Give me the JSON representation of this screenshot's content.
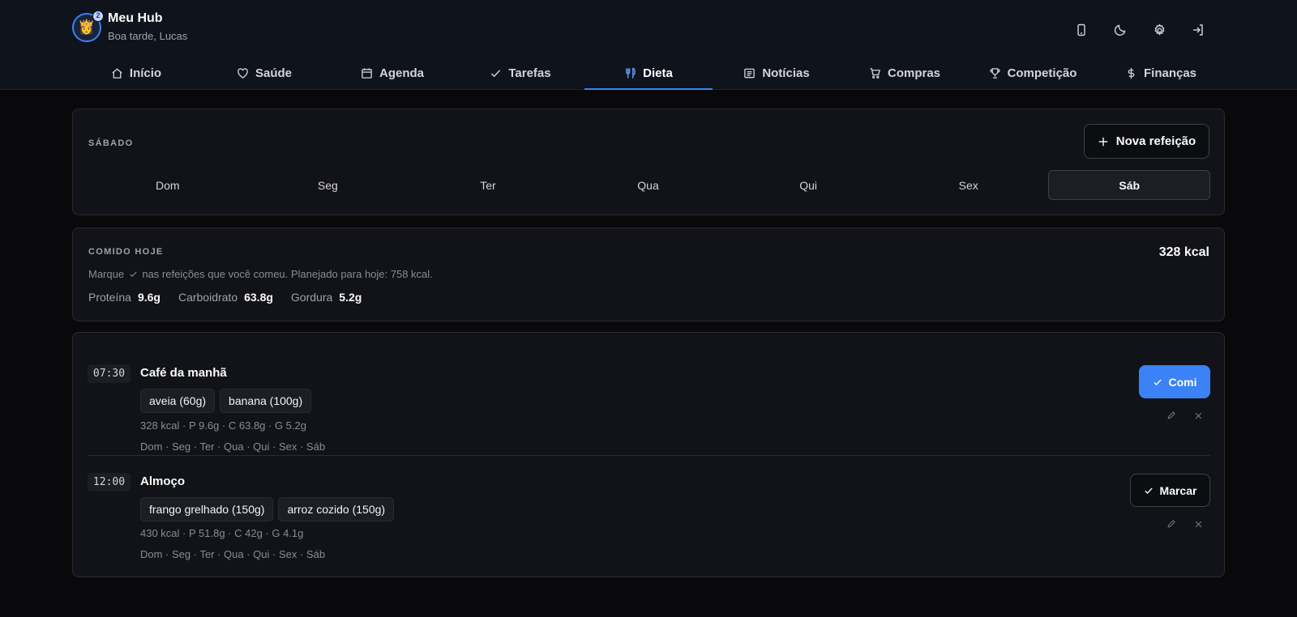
{
  "header": {
    "title": "Meu Hub",
    "greeting": "Boa tarde, Lucas",
    "avatar_badge": "2",
    "actions": [
      "mobile-icon",
      "moon-icon",
      "gear-icon",
      "logout-icon"
    ]
  },
  "nav": {
    "tabs": [
      {
        "label": "Início",
        "icon": "home-icon"
      },
      {
        "label": "Saúde",
        "icon": "heart-icon"
      },
      {
        "label": "Agenda",
        "icon": "calendar-icon"
      },
      {
        "label": "Tarefas",
        "icon": "check-icon"
      },
      {
        "label": "Dieta",
        "icon": "utensils-icon",
        "active": true
      },
      {
        "label": "Notícias",
        "icon": "newspaper-icon"
      },
      {
        "label": "Compras",
        "icon": "cart-icon"
      },
      {
        "label": "Competição",
        "icon": "trophy-icon"
      },
      {
        "label": "Finanças",
        "icon": "dollar-icon"
      }
    ]
  },
  "day_selector": {
    "label": "SÁBADO",
    "new_meal_label": "Nova refeição",
    "days": [
      "Dom",
      "Seg",
      "Ter",
      "Qua",
      "Qui",
      "Sex",
      "Sáb"
    ],
    "active_day": "Sáb"
  },
  "eaten_today": {
    "label": "COMIDO HOJE",
    "total": "328 kcal",
    "hint_prefix": "Marque",
    "hint_suffix": "nas refeições que você comeu. Planejado para hoje: 758 kcal.",
    "macros": [
      {
        "name": "Proteína",
        "value": "9.6g"
      },
      {
        "name": "Carboidrato",
        "value": "63.8g"
      },
      {
        "name": "Gordura",
        "value": "5.2g"
      }
    ]
  },
  "meals": [
    {
      "time": "07:30",
      "title": "Café da manhã",
      "items": [
        "aveia (60g)",
        "banana (100g)"
      ],
      "info": "328 kcal · P 9.6g · C 63.8g · G 5.2g",
      "days": "Dom · Seg · Ter · Qua · Qui · Sex · Sáb",
      "action_label": "Comi",
      "eaten": true
    },
    {
      "time": "12:00",
      "title": "Almoço",
      "items": [
        "frango grelhado (150g)",
        "arroz cozido (150g)"
      ],
      "info": "430 kcal · P 51.8g · C 42g · G 4.1g",
      "days": "Dom · Seg · Ter · Qua · Qui · Sex · Sáb",
      "action_label": "Marcar",
      "eaten": false
    }
  ],
  "colors": {
    "accent": "#3b82f6",
    "background": "#09090b",
    "card": "#121318"
  }
}
